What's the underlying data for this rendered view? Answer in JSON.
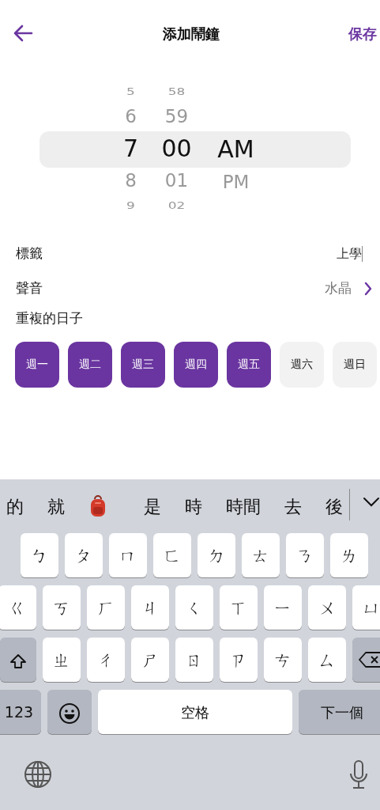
{
  "header": {
    "title": "添加鬧鐘",
    "save": "保存"
  },
  "picker": {
    "columns": [
      {
        "kind": "hour",
        "items": [
          {
            "text": "5",
            "selected": false
          },
          {
            "text": "6",
            "selected": false
          },
          {
            "text": "7",
            "selected": true
          },
          {
            "text": "8",
            "selected": false
          },
          {
            "text": "9",
            "selected": false
          }
        ]
      },
      {
        "kind": "minute",
        "items": [
          {
            "text": "58",
            "selected": false
          },
          {
            "text": "59",
            "selected": false
          },
          {
            "text": "00",
            "selected": true
          },
          {
            "text": "01",
            "selected": false
          },
          {
            "text": "02",
            "selected": false
          }
        ]
      },
      {
        "kind": "period",
        "items": [
          {
            "text": "AM",
            "selected": true
          },
          {
            "text": "PM",
            "selected": false
          }
        ]
      }
    ]
  },
  "label_row": {
    "label": "標籤",
    "value": "上學"
  },
  "sound_row": {
    "label": "聲音",
    "value": "水晶"
  },
  "repeat": {
    "label": "重複的日子",
    "days": [
      {
        "text": "週一",
        "selected": true
      },
      {
        "text": "週二",
        "selected": true
      },
      {
        "text": "週三",
        "selected": true
      },
      {
        "text": "週四",
        "selected": true
      },
      {
        "text": "週五",
        "selected": true
      },
      {
        "text": "週六",
        "selected": false
      },
      {
        "text": "週日",
        "selected": false
      }
    ]
  },
  "keyboard": {
    "candidates": [
      {
        "kind": "text",
        "text": "的"
      },
      {
        "kind": "text",
        "text": "就"
      },
      {
        "kind": "emoji"
      },
      {
        "kind": "text",
        "text": "是"
      },
      {
        "kind": "text",
        "text": "時"
      },
      {
        "kind": "text",
        "text": "時間"
      },
      {
        "kind": "text",
        "text": "去"
      },
      {
        "kind": "text",
        "text": "後"
      }
    ],
    "rows": [
      [
        "ㄅ",
        "ㄆ",
        "ㄇ",
        "ㄈ",
        "ㄉ",
        "ㄊ",
        "ㄋ",
        "ㄌ"
      ],
      [
        "ㄍ",
        "ㄎ",
        "ㄏ",
        "ㄐ",
        "ㄑ",
        "ㄒ",
        "ㄧ",
        "ㄨ",
        "ㄩ"
      ],
      [
        "ㄓ",
        "ㄔ",
        "ㄕ",
        "ㄖ",
        "ㄗ",
        "ㄘ",
        "ㄙ"
      ]
    ],
    "numbers_key": "123",
    "space_key": "空格",
    "next_key": "下一個"
  }
}
